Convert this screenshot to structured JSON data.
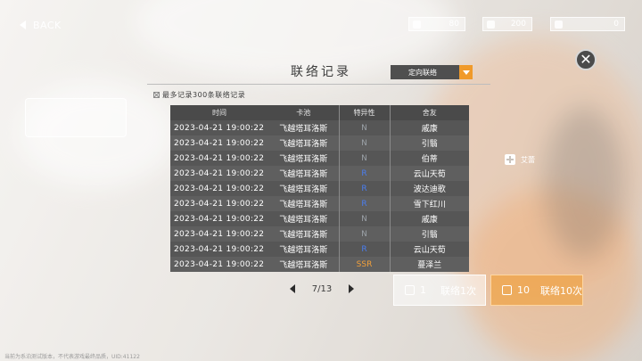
{
  "topbar": {
    "back_label": "BACK",
    "resources": [
      {
        "icon": "crystal-icon",
        "value": "80"
      },
      {
        "icon": "ticket-icon",
        "value": "200"
      },
      {
        "icon": "coin-icon",
        "value": "0"
      }
    ]
  },
  "dialog": {
    "title": "联络记录",
    "dropdown_value": "定向联络",
    "note": "最多记录300条联络记录",
    "columns": [
      "时间",
      "卡池",
      "特异性",
      "舍友"
    ],
    "rows": [
      {
        "time": "2023-04-21 19:00:22",
        "pool": "飞越塔耳洛斯",
        "rarity": "N",
        "rarity_class": "r-n",
        "name": "戚康"
      },
      {
        "time": "2023-04-21 19:00:22",
        "pool": "飞越塔耳洛斯",
        "rarity": "N",
        "rarity_class": "r-n",
        "name": "引翳"
      },
      {
        "time": "2023-04-21 19:00:22",
        "pool": "飞越塔耳洛斯",
        "rarity": "N",
        "rarity_class": "r-n",
        "name": "伯蒂"
      },
      {
        "time": "2023-04-21 19:00:22",
        "pool": "飞越塔耳洛斯",
        "rarity": "R",
        "rarity_class": "r-r",
        "name": "云山天荀"
      },
      {
        "time": "2023-04-21 19:00:22",
        "pool": "飞越塔耳洛斯",
        "rarity": "R",
        "rarity_class": "r-r",
        "name": "波达迪歌"
      },
      {
        "time": "2023-04-21 19:00:22",
        "pool": "飞越塔耳洛斯",
        "rarity": "R",
        "rarity_class": "r-r",
        "name": "雪下红川"
      },
      {
        "time": "2023-04-21 19:00:22",
        "pool": "飞越塔耳洛斯",
        "rarity": "N",
        "rarity_class": "r-n",
        "name": "戚康"
      },
      {
        "time": "2023-04-21 19:00:22",
        "pool": "飞越塔耳洛斯",
        "rarity": "N",
        "rarity_class": "r-n",
        "name": "引翳"
      },
      {
        "time": "2023-04-21 19:00:22",
        "pool": "飞越塔耳洛斯",
        "rarity": "R",
        "rarity_class": "r-r",
        "name": "云山天荀"
      },
      {
        "time": "2023-04-21 19:00:22",
        "pool": "飞越塔耳洛斯",
        "rarity": "SSR",
        "rarity_class": "r-ssr",
        "name": "蔓泽兰"
      }
    ],
    "pager": "7/13"
  },
  "background_ui": {
    "side_tag": "艾蕾",
    "btn_single_count": "1",
    "btn_single_label": "联络1次",
    "btn_multi_count": "10",
    "btn_multi_label": "联络10次",
    "footer": "当前为系泊测试版本，不代表游戏最终品质，UID:41122"
  },
  "colors": {
    "accent": "#f09a2a",
    "rarity_n": "#9aa0a6",
    "rarity_r": "#4a7ef0",
    "rarity_ssr": "#f2a03b"
  }
}
